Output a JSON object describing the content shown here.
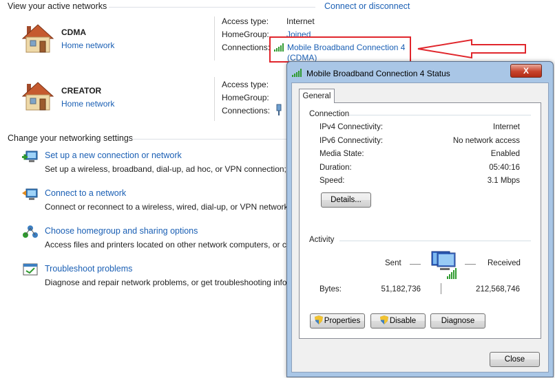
{
  "active_networks": {
    "header": "View your active networks",
    "connect_link": "Connect or disconnect",
    "networks": [
      {
        "name": "CDMA",
        "type": "Home network",
        "access_type_label": "Access type:",
        "access_type_value": "Internet",
        "homegroup_label": "HomeGroup:",
        "homegroup_value": "Joined",
        "connections_label": "Connections:",
        "connection_line1": "Mobile Broadband Connection 4",
        "connection_line2": "(CDMA)"
      },
      {
        "name": "CREATOR",
        "type": "Home network",
        "access_type_label": "Access type:",
        "homegroup_label": "HomeGroup:",
        "connections_label": "Connections:"
      }
    ]
  },
  "settings": {
    "header": "Change your networking settings",
    "items": [
      {
        "title": "Set up a new connection or network",
        "desc": "Set up a wireless, broadband, dial-up, ad hoc, or VPN connection; o"
      },
      {
        "title": "Connect to a network",
        "desc": "Connect or reconnect to a wireless, wired, dial-up, or VPN network"
      },
      {
        "title": "Choose homegroup and sharing options",
        "desc": "Access files and printers located on other network computers, or cl"
      },
      {
        "title": "Troubleshoot problems",
        "desc": "Diagnose and repair network problems, or get troubleshooting info"
      }
    ]
  },
  "dialog": {
    "title": "Mobile Broadband Connection 4 Status",
    "close_x": "X",
    "tab": "General",
    "connection_group": "Connection",
    "rows": [
      {
        "label": "IPv4 Connectivity:",
        "value": "Internet"
      },
      {
        "label": "IPv6 Connectivity:",
        "value": "No network access"
      },
      {
        "label": "Media State:",
        "value": "Enabled"
      },
      {
        "label": "Duration:",
        "value": "05:40:16"
      },
      {
        "label": "Speed:",
        "value": "3.1 Mbps"
      }
    ],
    "details_button": "Details...",
    "activity_group": "Activity",
    "sent_label": "Sent",
    "received_label": "Received",
    "bytes_label": "Bytes:",
    "bytes_sent": "51,182,736",
    "bytes_received": "212,568,746",
    "properties_button": "Properties",
    "disable_button": "Disable",
    "diagnose_button": "Diagnose",
    "close_button": "Close"
  },
  "colors": {
    "link": "#1a5fb4",
    "highlight_red": "#e0252b"
  }
}
